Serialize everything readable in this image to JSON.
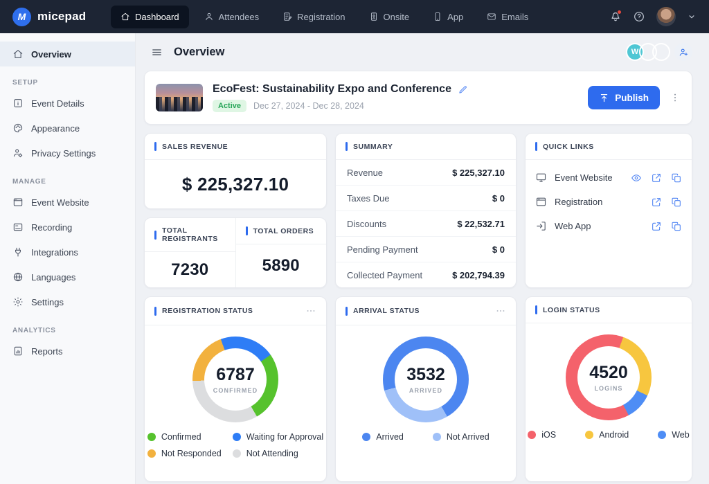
{
  "nav": {
    "brand": "micepad",
    "items": [
      {
        "label": "Dashboard",
        "icon": "home-icon",
        "active": true
      },
      {
        "label": "Attendees",
        "icon": "person-icon",
        "active": false
      },
      {
        "label": "Registration",
        "icon": "registration-icon",
        "active": false
      },
      {
        "label": "Onsite",
        "icon": "onsite-icon",
        "active": false
      },
      {
        "label": "App",
        "icon": "app-icon",
        "active": false
      },
      {
        "label": "Emails",
        "icon": "email-icon",
        "active": false
      }
    ],
    "right": {
      "has_notification": true
    }
  },
  "sidebar": {
    "overview": {
      "label": "Overview",
      "icon": "home-icon",
      "active": true
    },
    "sections": [
      {
        "title": "SETUP",
        "items": [
          {
            "label": "Event Details",
            "icon": "info-icon"
          },
          {
            "label": "Appearance",
            "icon": "palette-icon"
          },
          {
            "label": "Privacy Settings",
            "icon": "privacy-icon"
          }
        ]
      },
      {
        "title": "MANAGE",
        "items": [
          {
            "label": "Event Website",
            "icon": "browser-icon"
          },
          {
            "label": "Recording",
            "icon": "recording-icon"
          },
          {
            "label": "Integrations",
            "icon": "plug-icon"
          },
          {
            "label": "Languages",
            "icon": "globe-icon"
          },
          {
            "label": "Settings",
            "icon": "gear-icon"
          }
        ]
      },
      {
        "title": "ANALYTICS",
        "items": [
          {
            "label": "Reports",
            "icon": "report-icon"
          }
        ]
      }
    ]
  },
  "header": {
    "title": "Overview",
    "avatars": [
      {
        "type": "initial",
        "text": "W",
        "color": "#4fc7d4"
      },
      {
        "type": "photo",
        "name": "avatar-man"
      },
      {
        "type": "photo",
        "name": "avatar-woman"
      }
    ]
  },
  "event": {
    "title": "EcoFest: Sustainability Expo and Conference",
    "status": "Active",
    "dates": "Dec 27, 2024 - Dec 28, 2024",
    "publish_label": "Publish"
  },
  "cards": {
    "sales_revenue": {
      "title": "SALES REVENUE",
      "value": "$ 225,327.10"
    },
    "totals": {
      "registrants_title": "TOTAL REGISTRANTS",
      "registrants_value": "7230",
      "orders_title": "TOTAL ORDERS",
      "orders_value": "5890"
    },
    "summary": {
      "title": "SUMMARY",
      "rows": [
        {
          "label": "Revenue",
          "value": "$ 225,327.10"
        },
        {
          "label": "Taxes Due",
          "value": "$ 0"
        },
        {
          "label": "Discounts",
          "value": "$ 22,532.71"
        },
        {
          "label": "Pending Payment",
          "value": "$ 0"
        },
        {
          "label": "Collected Payment",
          "value": "$ 202,794.39"
        }
      ]
    },
    "quick_links": {
      "title": "QUICK LINKS",
      "links": [
        {
          "label": "Event Website",
          "icon": "monitor-icon",
          "actions": [
            "eye-icon",
            "external-link-icon",
            "copy-icon"
          ]
        },
        {
          "label": "Registration",
          "icon": "browser-icon",
          "actions": [
            "external-link-icon",
            "copy-icon"
          ]
        },
        {
          "label": "Web App",
          "icon": "login-icon",
          "actions": [
            "external-link-icon",
            "copy-icon"
          ]
        }
      ]
    }
  },
  "chart_data": [
    {
      "id": "registration",
      "type": "donut",
      "title": "REGISTRATION STATUS",
      "center_value": "6787",
      "center_label": "CONFIRMED",
      "start_deg": 340,
      "has_menu": true,
      "legend_layout": "two-col",
      "segments": [
        {
          "label": "Waiting for Approval",
          "color": "#2e7df6",
          "pct": 20.8
        },
        {
          "label": "Confirmed",
          "color": "#56c22d",
          "pct": 26.4
        },
        {
          "label": "Not Attending",
          "color": "#dcdddf",
          "pct": 32.8
        },
        {
          "label": "Not Responded",
          "color": "#f2b13e",
          "pct": 20.0
        }
      ],
      "legend": [
        {
          "label": "Confirmed",
          "color": "#56c22d"
        },
        {
          "label": "Waiting for Approval",
          "color": "#2e7df6"
        },
        {
          "label": "Not Responded",
          "color": "#f2b13e"
        },
        {
          "label": "Not Attending",
          "color": "#dcdddf"
        }
      ]
    },
    {
      "id": "arrival",
      "type": "donut",
      "title": "ARRIVAL STATUS",
      "center_value": "3532",
      "center_label": "ARRIVED",
      "start_deg": 150,
      "has_menu": true,
      "legend_layout": "row",
      "segments": [
        {
          "label": "Not Arrived",
          "color": "#9fc0f8",
          "pct": 29.2
        },
        {
          "label": "Arrived",
          "color": "#4c86f0",
          "pct": 70.8
        }
      ],
      "legend": [
        {
          "label": "Arrived",
          "color": "#4c86f0"
        },
        {
          "label": "Not Arrived",
          "color": "#9fc0f8"
        }
      ]
    },
    {
      "id": "login",
      "type": "donut",
      "title": "LOGIN STATUS",
      "center_value": "4520",
      "center_label": "LOGINS",
      "start_deg": 20,
      "has_menu": false,
      "legend_layout": "row",
      "segments": [
        {
          "label": "Android",
          "color": "#f7c63f",
          "pct": 26.4
        },
        {
          "label": "Web",
          "color": "#4e8df5",
          "pct": 10.3
        },
        {
          "label": "iOS",
          "color": "#f4626b",
          "pct": 63.3
        }
      ],
      "legend": [
        {
          "label": "iOS",
          "color": "#f4626b"
        },
        {
          "label": "Android",
          "color": "#f7c63f"
        },
        {
          "label": "Web",
          "color": "#4e8df5"
        }
      ]
    }
  ],
  "colors": {
    "accent": "#2e6bee",
    "badge_green_bg": "#dff6e4",
    "badge_green_text": "#27a558"
  }
}
